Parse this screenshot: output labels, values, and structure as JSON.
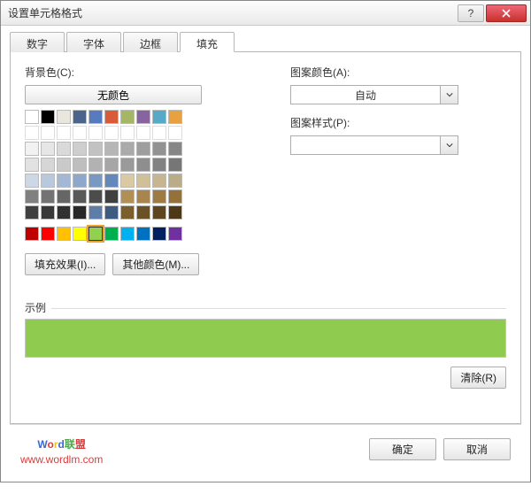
{
  "title": "设置单元格格式",
  "tabs": {
    "t0": "数字",
    "t1": "字体",
    "t2": "边框",
    "t3": "填充"
  },
  "fill": {
    "bg_label": "背景色(C):",
    "no_color_label": "无颜色",
    "fill_effects_btn": "填充效果(I)...",
    "more_colors_btn": "其他颜色(M)...",
    "pattern_color_label": "图案颜色(A):",
    "pattern_color_value": "自动",
    "pattern_style_label": "图案样式(P):",
    "pattern_style_value": "",
    "sample_label": "示例",
    "sample_color": "#8fcb4e",
    "clear_btn": "清除(R)",
    "palette_row1": [
      "#ffffff",
      "#000000",
      "#e9e6de",
      "#4b648c",
      "#567bbf",
      "#d85a39",
      "#a5b765",
      "#88649f",
      "#56aac7",
      "#e7a140"
    ],
    "palette_gray": [
      [
        "#f2f2f2",
        "#e6e6e6",
        "#dadada",
        "#cecece",
        "#c2c2c2",
        "#b6b6b6",
        "#aaaaaa",
        "#9e9e9e",
        "#929292",
        "#868686"
      ],
      [
        "#e2e2e2",
        "#d6d6d6",
        "#cacaca",
        "#bebebe",
        "#b2b2b2",
        "#a6a6a6",
        "#9a9a9a",
        "#8e8e8e",
        "#828282",
        "#767676"
      ],
      [
        "#cdd8e6",
        "#b8c8dd",
        "#a3b8d4",
        "#8ea8cb",
        "#7998c2",
        "#6488b9",
        "#d9caa3",
        "#cfc09a",
        "#c5b691",
        "#bbac88"
      ],
      [
        "#808080",
        "#737373",
        "#666666",
        "#595959",
        "#4c4c4c",
        "#3f3f3f",
        "#b28f55",
        "#a8854c",
        "#9e7b43",
        "#94713a"
      ],
      [
        "#404040",
        "#383838",
        "#303030",
        "#282828",
        "#5e7da8",
        "#3f5b82",
        "#7a5f2d",
        "#6b5226",
        "#5c451f",
        "#4d3818"
      ]
    ],
    "standard_colors": [
      "#c00000",
      "#ff0000",
      "#ffc000",
      "#ffff00",
      "#92d050",
      "#00b050",
      "#00b0f0",
      "#0070c0",
      "#002060",
      "#7030a0"
    ],
    "selected_standard_index": 4
  },
  "footer": {
    "ok": "确定",
    "cancel": "取消"
  },
  "watermark": {
    "line1_chars": [
      "W",
      "o",
      "r",
      "d",
      "联",
      "盟"
    ],
    "line2": "www.wordlm.com"
  }
}
